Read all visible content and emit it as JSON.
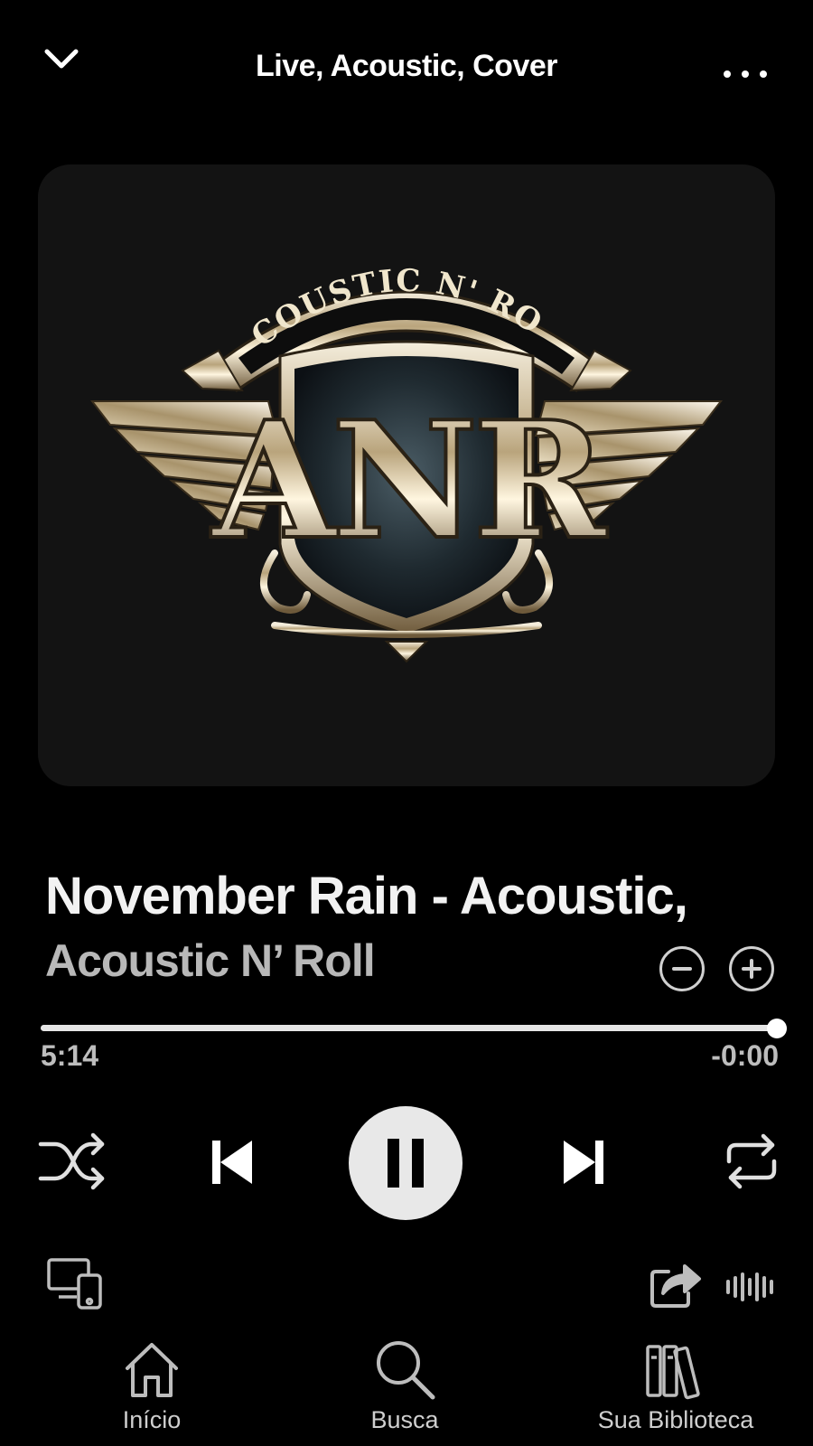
{
  "header": {
    "title": "Live, Acoustic, Cover",
    "collapse_icon": "chevron-down-icon",
    "more_icon": "more-dots-icon"
  },
  "cover": {
    "banner_text": "ACOUSTIC N' ROLL",
    "shield_letters": "ANR"
  },
  "track": {
    "title": "November Rain - Acoustic,",
    "artist": "Acoustic N’ Roll"
  },
  "playback": {
    "elapsed": "5:14",
    "remaining": "-0:00",
    "progress": 1.0,
    "state": "playing"
  },
  "controls": {
    "shuffle_icon": "shuffle-icon",
    "previous_icon": "skip-previous-icon",
    "pause_icon": "pause-icon",
    "next_icon": "skip-next-icon",
    "repeat_icon": "repeat-icon"
  },
  "nav": {
    "items": [
      {
        "label": "Início",
        "icon": "home-icon"
      },
      {
        "label": "Busca",
        "icon": "search-icon"
      },
      {
        "label": "Sua Biblioteca",
        "icon": "library-icon"
      }
    ]
  },
  "colors": {
    "background": "#000000",
    "cover_bg": "#131313",
    "text_primary": "#f2f2f2",
    "text_secondary": "#b8b8b8",
    "accent": "#e8e8e8"
  }
}
